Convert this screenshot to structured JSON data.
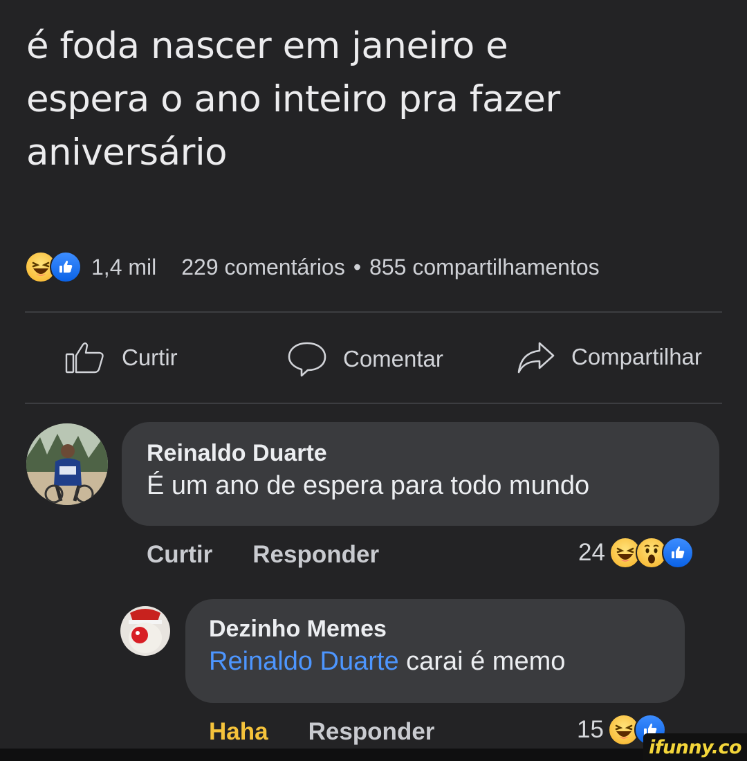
{
  "post": {
    "text_lines": [
      "é foda nascer em janeiro e",
      "espera o ano inteiro pra fazer",
      "aniversário"
    ]
  },
  "stats": {
    "likes": "1,4 mil",
    "comments": "229 comentários",
    "separator": "•",
    "shares": "855 compartilhamentos",
    "reactions": [
      "haha-icon",
      "like-icon"
    ]
  },
  "actions": {
    "like_label": "Curtir",
    "comment_label": "Comentar",
    "share_label": "Compartilhar"
  },
  "comments": [
    {
      "author": "Reinaldo Duarte",
      "text": "É um ano de espera para todo mundo",
      "like_label": "Curtir",
      "reply_label": "Responder",
      "reaction_count": "24",
      "reactions": [
        "haha-icon",
        "wow-icon",
        "like-icon"
      ]
    },
    {
      "author": "Dezinho Memes",
      "mention": "Reinaldo Duarte",
      "text": "carai é memo",
      "like_label": "Haha",
      "reply_label": "Responder",
      "reaction_count": "15",
      "reactions": [
        "haha-icon",
        "like-icon"
      ]
    }
  ],
  "watermark": "ifunny.co",
  "colors": {
    "background": "#232325",
    "bubble": "#3a3b3e",
    "mention": "#4d96ff",
    "haha_label": "#f5c33b",
    "watermark": "#f4d63a"
  }
}
